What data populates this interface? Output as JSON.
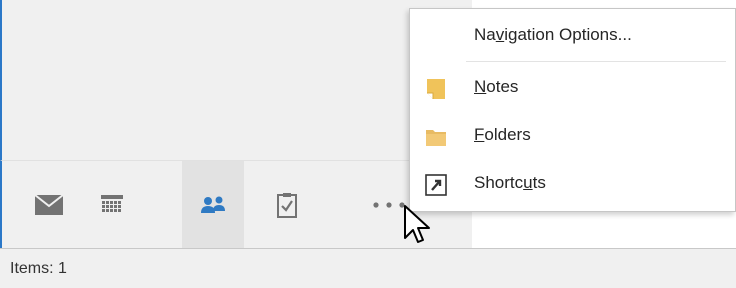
{
  "status": {
    "items_text": "Items: 1"
  },
  "navigation": {
    "buttons": [
      {
        "name": "mail",
        "icon": "envelope-icon"
      },
      {
        "name": "calendar",
        "icon": "calendar-grid-icon"
      },
      {
        "name": "people",
        "icon": "people-icon",
        "selected": true
      },
      {
        "name": "tasks",
        "icon": "clipboard-check-icon"
      },
      {
        "name": "more",
        "icon": "ellipsis-icon"
      }
    ]
  },
  "menu": {
    "items": [
      {
        "label": "Navigation Options...",
        "underline_char": "v",
        "icon": ""
      },
      {
        "label": "Notes",
        "underline_char": "N",
        "icon": "note-icon"
      },
      {
        "label": "Folders",
        "underline_char": "F",
        "icon": "folder-icon"
      },
      {
        "label": "Shortcuts",
        "underline_char": "u",
        "icon": "shortcut-arrow-icon"
      }
    ]
  },
  "colors": {
    "accent_blue": "#2b78c8",
    "people_icon_blue": "#2f7ac3",
    "note_yellow": "#f0c35a",
    "folder_yellow": "#e8bb63",
    "icon_gray": "#737373"
  }
}
